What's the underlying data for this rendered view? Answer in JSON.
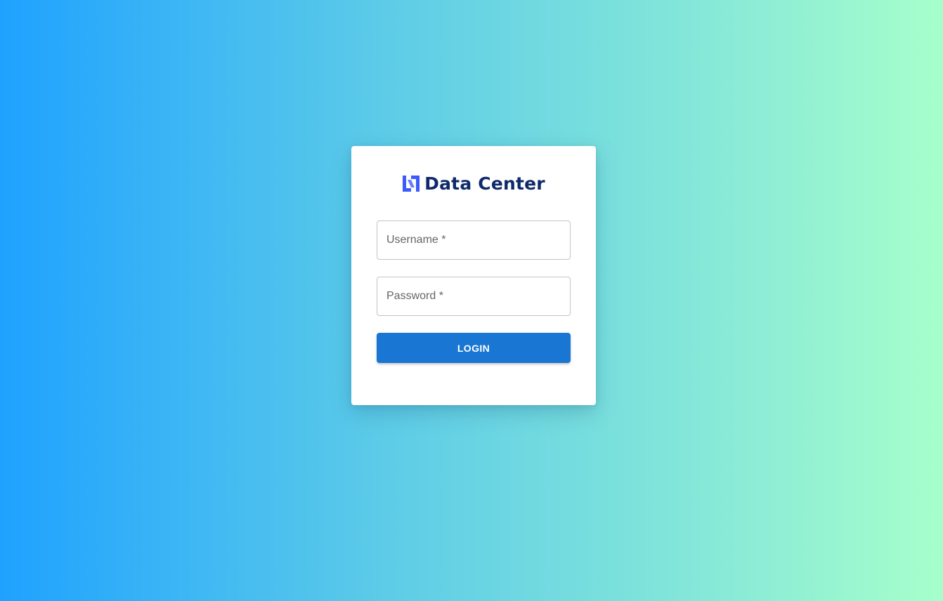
{
  "brand": {
    "name": "Data Center",
    "logo_icon": "dc-logo-icon",
    "logo_color": "#3d5afe",
    "name_color": "#0f2a6b"
  },
  "form": {
    "username": {
      "label": "Username *",
      "value": ""
    },
    "password": {
      "label": "Password *",
      "value": ""
    },
    "submit_label": "LOGIN"
  },
  "colors": {
    "background_start": "#1fa2ff",
    "background_end": "#a6ffcb",
    "button": "#1976d2"
  }
}
